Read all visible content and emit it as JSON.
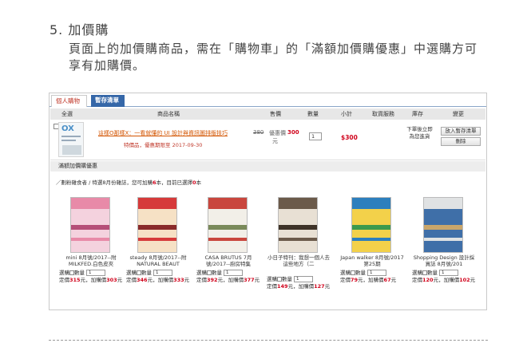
{
  "step": {
    "title": "5. 加價購",
    "desc": "頁面上的加價購商品，需在「購物車」的「滿額加價購優惠」中選購方可享有加購價。"
  },
  "tabs": {
    "cart": "個人購物車",
    "hold": "暫存清單"
  },
  "table_headers": {
    "select": "全選",
    "name": "商品名稱",
    "price": "售價",
    "qty": "數量",
    "subtotal": "小計",
    "service": "取貨服務",
    "stock": "庫存",
    "change": "變更"
  },
  "cart_item": {
    "name": "這樣O那樣X：一看就懂的 UI 設計與資訊圖排版技巧",
    "note": "特價品，優惠期限至 2017-09-30",
    "price_original": "380",
    "price_sale_label": "優惠價",
    "price_sale": "300",
    "price_unit": "元",
    "qty": "1",
    "subtotal": "$300",
    "stock": "下單後立即為您進貨",
    "btn_hold": "放入暫存清單",
    "btn_delete": "刪除"
  },
  "promo": {
    "bar_title": "滿額加價購優惠",
    "info_prefix": "／劃粉雜食者 / 特選8月份雜誌，您可加購",
    "info_count": "6",
    "info_mid": "本，目前已選擇",
    "info_selected": "0",
    "info_suffix": "本"
  },
  "addon_items": [
    {
      "name": "mini 8月號/2017--附MILKFED.白色皮夾",
      "select_label": "選購",
      "qty_label": "數量",
      "qty": "1",
      "price_label": "定價",
      "price": "315",
      "addon_label": "加購價",
      "addon_price": "303",
      "unit": "元",
      "colors": [
        "#e88aa8",
        "#f4d2de",
        "#b54f78"
      ]
    },
    {
      "name": "steady 8月號/2017--附NATURAL BEAUT",
      "select_label": "選購",
      "qty_label": "數量",
      "qty": "1",
      "price_label": "定價",
      "price": "346",
      "addon_label": "加購價",
      "addon_price": "333",
      "unit": "元",
      "colors": [
        "#d63a3a",
        "#f6e1c5",
        "#8a2a2a"
      ]
    },
    {
      "name": "CASA BRUTUS 7月號/2017--廚房特集",
      "select_label": "選購",
      "qty_label": "數量",
      "qty": "1",
      "price_label": "定價",
      "price": "392",
      "addon_label": "加購價",
      "addon_price": "377",
      "unit": "元",
      "colors": [
        "#c9463d",
        "#f2efe8",
        "#7a8a5a"
      ]
    },
    {
      "name": "小日子特刊：我想一個人去這些地方（二",
      "select_label": "選購",
      "qty_label": "數量",
      "qty": "1",
      "price_label": "定價",
      "price": "149",
      "addon_label": "加購價",
      "addon_price": "127",
      "unit": "元",
      "colors": [
        "#6b5a4a",
        "#e8e0d4",
        "#3e3328"
      ]
    },
    {
      "name": "Japan walker 8月號/2017 第25期",
      "select_label": "選購",
      "qty_label": "數量",
      "qty": "1",
      "price_label": "定價",
      "price": "79",
      "addon_label": "加購價",
      "addon_price": "67",
      "unit": "元",
      "colors": [
        "#2d7fbd",
        "#f3d14a",
        "#3c9a4d"
      ]
    },
    {
      "name": "Shopping Design 設計採買誌 8月號/201",
      "select_label": "選購",
      "qty_label": "數量",
      "qty": "1",
      "price_label": "定價",
      "price": "120",
      "addon_label": "加購價",
      "addon_price": "102",
      "unit": "元",
      "colors": [
        "#e0e2e3",
        "#3f6fa8",
        "#c9a66b"
      ]
    }
  ]
}
